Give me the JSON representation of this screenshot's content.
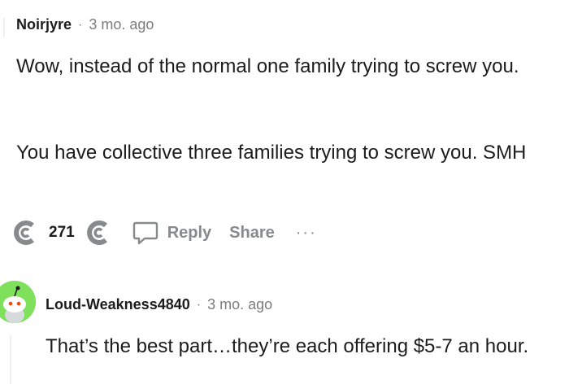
{
  "comments": [
    {
      "username": "Noirjyre",
      "separator": "·",
      "age": "3 mo. ago",
      "paragraphs": [
        "Wow, instead of the normal one family trying to screw you.",
        "You have collective three families trying to screw you. SMH"
      ],
      "score": "271",
      "actions": {
        "reply": "Reply",
        "share": "Share",
        "more": "···"
      },
      "icons": [
        "upvote-icon",
        "downvote-icon",
        "reply-icon"
      ]
    },
    {
      "username": "Loud-Weakness4840",
      "separator": "·",
      "age": "3 mo. ago",
      "paragraphs": [
        "That’s the best part…they’re each offering $5-7 an hour."
      ],
      "avatar_color": "#7ee05b"
    }
  ],
  "colors": {
    "meta": "#7c7c7c",
    "action": "#878a8c",
    "text": "#1c1c1c"
  }
}
